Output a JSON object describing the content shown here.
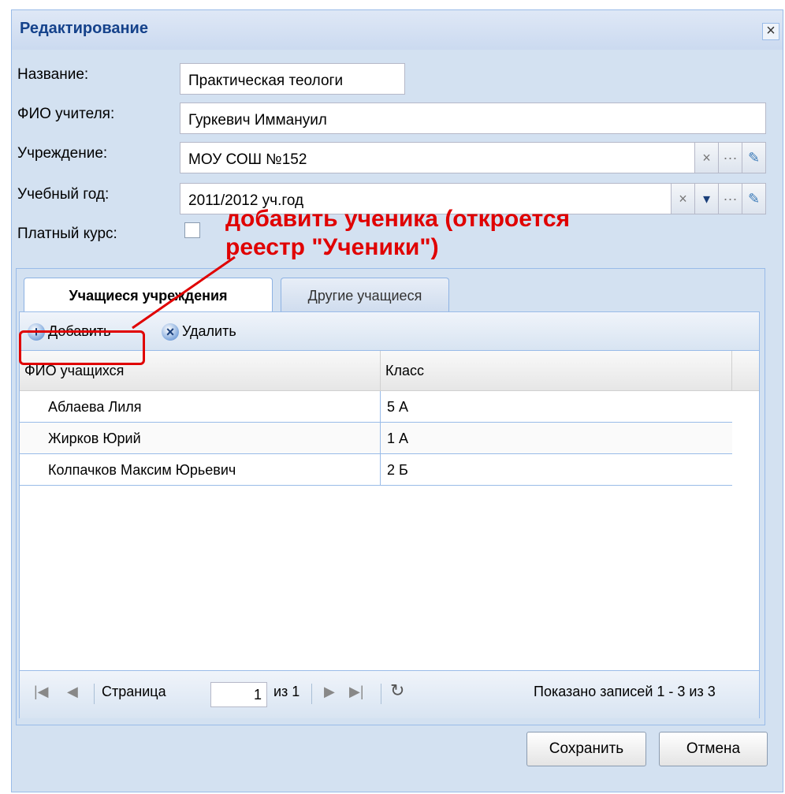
{
  "window": {
    "title": "Редактирование",
    "close_icon": "close-icon"
  },
  "form": {
    "name_label": "Название:",
    "name_value": "Практическая теологи",
    "teacher_label": "ФИО учителя:",
    "teacher_value": "Гуркевич Иммануил",
    "institution_label": "Учреждение:",
    "institution_value": "МОУ СОШ №152",
    "year_label": "Учебный год:",
    "year_value": "2011/2012 уч.год",
    "paid_label": "Платный курс:",
    "paid_checked": false,
    "clear_glyph": "×",
    "dropdown_glyph": "▾",
    "ellipsis_glyph": "···",
    "edit_glyph": "✎"
  },
  "annotation": {
    "line1": "добавить ученика (откроется",
    "line2": "реестр \"Ученики\")",
    "color": "#e00000"
  },
  "tabs": [
    {
      "label": "Учащиеся учреждения",
      "active": true
    },
    {
      "label": "Другие учащиеся",
      "active": false
    }
  ],
  "toolbar": {
    "add_label": "Добавить",
    "add_glyph": "+",
    "delete_label": "Удалить",
    "delete_glyph": "×"
  },
  "grid": {
    "columns": [
      "ФИО учащихся",
      "Класс"
    ],
    "rows": [
      {
        "name": "Аблаева Лиля",
        "class": "5 А"
      },
      {
        "name": "Жирков Юрий",
        "class": "1 А"
      },
      {
        "name": "Колпачков Максим Юрьевич",
        "class": "2 Б"
      }
    ]
  },
  "pager": {
    "page_label": "Страница",
    "page_value": "1",
    "of_label": "из 1",
    "status": "Показано записей 1 - 3 из 3",
    "first_glyph": "|◀",
    "prev_glyph": "◀",
    "next_glyph": "▶",
    "last_glyph": "▶|",
    "refresh_glyph": "↻"
  },
  "buttons": {
    "save": "Сохранить",
    "cancel": "Отмена"
  },
  "colors": {
    "accent": "#15428b",
    "panel": "#d3e1f1",
    "border": "#99bbe8"
  }
}
